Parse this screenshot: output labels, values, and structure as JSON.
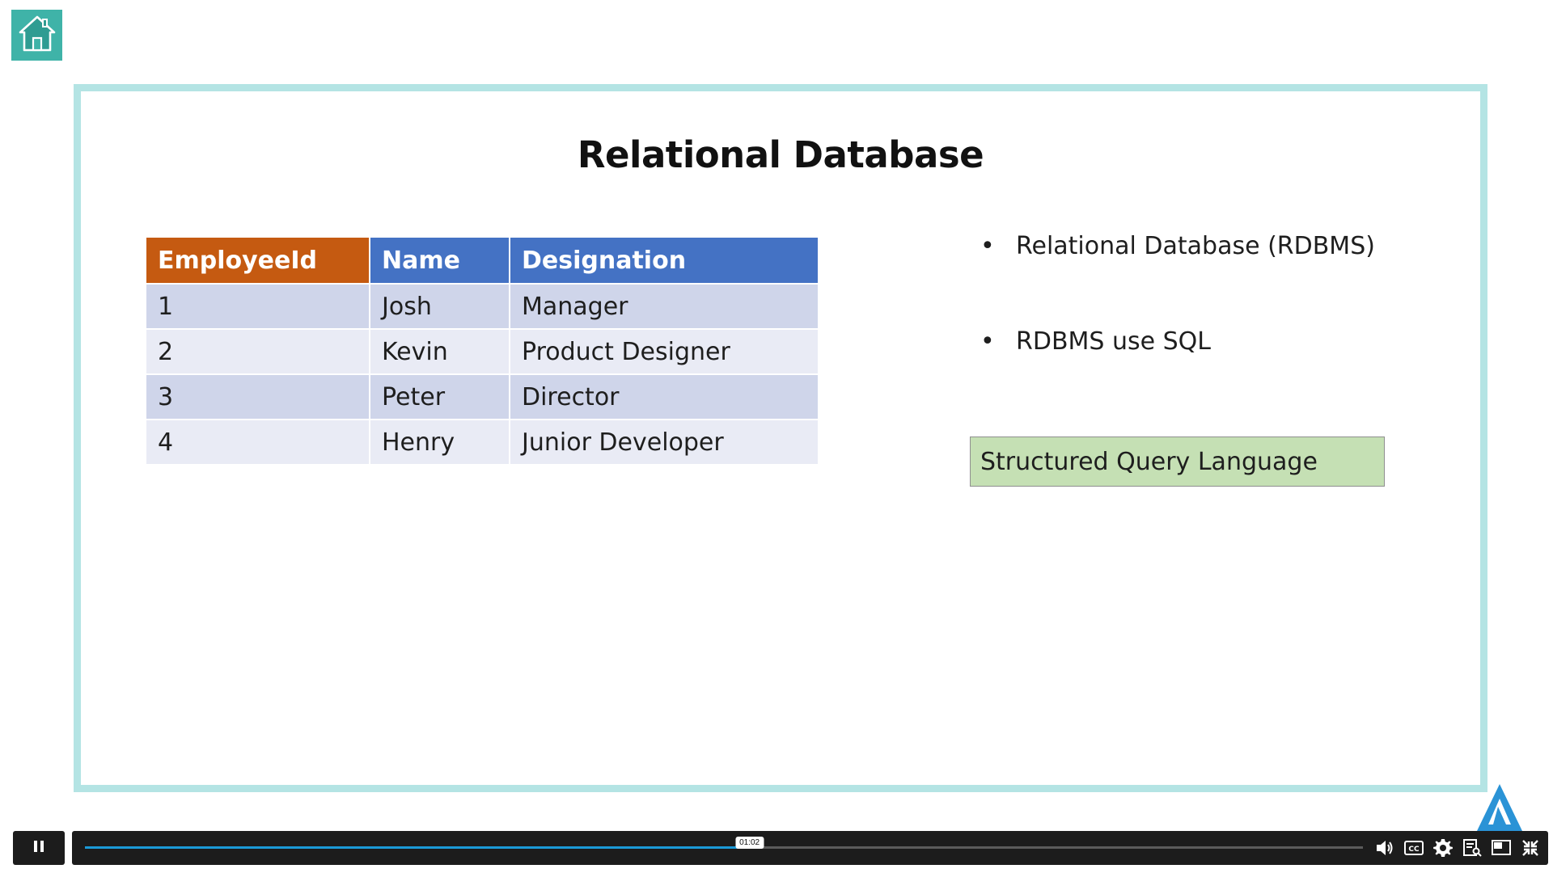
{
  "slide": {
    "title": "Relational Database",
    "table": {
      "headers": [
        "EmployeeId",
        "Name",
        "Designation"
      ],
      "rows": [
        [
          "1",
          "Josh",
          "Manager"
        ],
        [
          "2",
          "Kevin",
          "Product Designer"
        ],
        [
          "3",
          "Peter",
          "Director"
        ],
        [
          "4",
          "Henry",
          "Junior Developer"
        ]
      ]
    },
    "bullets": [
      "Relational Database (RDBMS)",
      "RDBMS use SQL"
    ],
    "box_label": "Structured Query Language"
  },
  "player": {
    "time_tooltip": "01:02",
    "progress_fraction": 0.52
  },
  "icons": [
    "home-icon",
    "pause-icon",
    "volume-icon",
    "cc-icon",
    "gear-icon",
    "transcript-icon",
    "picture-in-picture-icon",
    "exit-fullscreen-icon",
    "logo-icon"
  ],
  "colors": {
    "frame": "#b4e4e4",
    "header_orange": "#c55a11",
    "header_blue": "#4472c4",
    "row_odd": "#cfd5ea",
    "row_even": "#e9ebf5",
    "box_green": "#c5e0b4",
    "progress": "#1b9ad7",
    "home_button": "#3fb3a8"
  }
}
